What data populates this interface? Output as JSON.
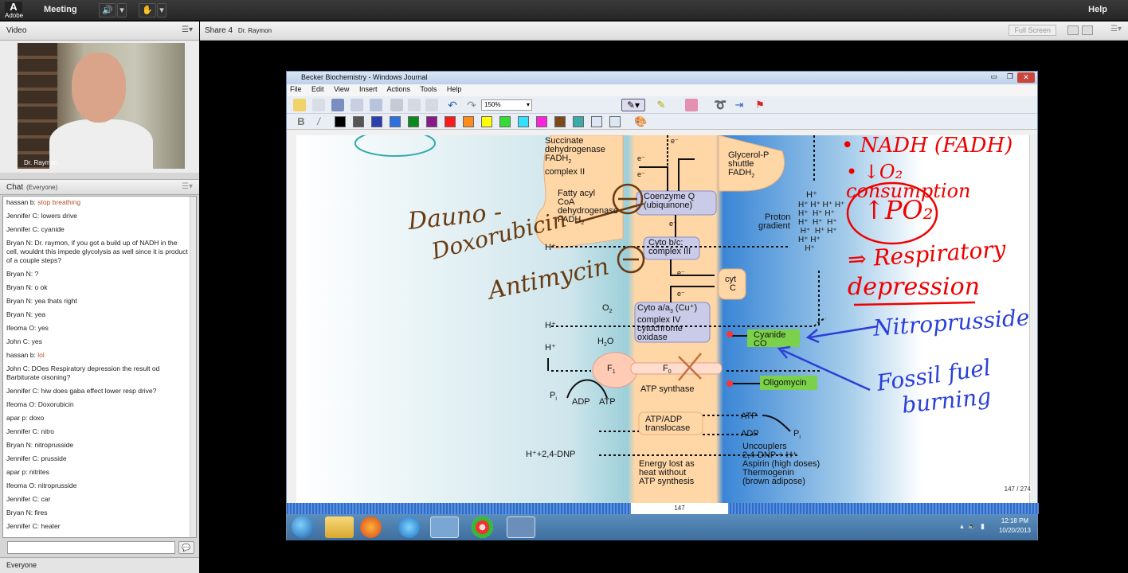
{
  "topbar": {
    "adobe": "Adobe",
    "meeting": "Meeting",
    "help": "Help"
  },
  "video_pod": {
    "title": "Video",
    "cam_label": "Dr. Raymon"
  },
  "chat_pod": {
    "title": "Chat",
    "audience": "(Everyone)",
    "footer": "Everyone",
    "messages": [
      {
        "user": "hassan b:",
        "text": "stop breathing",
        "highlight": true
      },
      {
        "user": "Jennifer C:",
        "text": "lowers drive"
      },
      {
        "user": "Jennifer C:",
        "text": "cyanide"
      },
      {
        "user": "Bryan N:",
        "text": "Dr. raymon, if you got a build up of NADH in the cell, wouldnt this impede glycolysis as well since it is product of a couple steps?"
      },
      {
        "user": "Bryan N:",
        "text": "?"
      },
      {
        "user": "Bryan N:",
        "text": "o ok"
      },
      {
        "user": "Bryan N:",
        "text": "yea thats right"
      },
      {
        "user": "Bryan N:",
        "text": "yea"
      },
      {
        "user": "Ifeoma O:",
        "text": "yes"
      },
      {
        "user": "John C:",
        "text": "yes"
      },
      {
        "user": "hassan b:",
        "text": "lol",
        "highlight": true
      },
      {
        "user": "John C:",
        "text": "DOes Respiratory depression the result od Barbiturate oisoning?"
      },
      {
        "user": "Jennifer C:",
        "text": "hiw does gaba effect lower resp drive?"
      },
      {
        "user": "Ifeoma O:",
        "text": "Doxorubicin"
      },
      {
        "user": "apar p:",
        "text": "doxo"
      },
      {
        "user": "Jennifer C:",
        "text": "nitro"
      },
      {
        "user": "Bryan N:",
        "text": "nitroprusside"
      },
      {
        "user": "Jennifer C:",
        "text": "prusside"
      },
      {
        "user": "apar p:",
        "text": "nitrites"
      },
      {
        "user": "Ifeoma O:",
        "text": "nitroprusside"
      },
      {
        "user": "Jennifer C:",
        "text": "car"
      },
      {
        "user": "Bryan N:",
        "text": "fires"
      },
      {
        "user": "Jennifer C:",
        "text": "heater"
      }
    ]
  },
  "share_pod": {
    "title": "Share 4",
    "presenter": "Dr. Raymon",
    "fullscreen": "Full Screen"
  },
  "journal": {
    "title": "Becker Biochemistry - Windows Journal",
    "menu": [
      "File",
      "Edit",
      "View",
      "Insert",
      "Actions",
      "Tools",
      "Help"
    ],
    "zoom": "150%",
    "page_counter": "147 / 274",
    "page_number": "147",
    "colors": [
      "#000000",
      "#555555",
      "#2a3fb0",
      "#2f6fe0",
      "#0a8a1e",
      "#8a1a8a",
      "#ff1a1a",
      "#ff8c1a",
      "#ffff00",
      "#33dd33",
      "#33e0ff",
      "#ff22dd",
      "#7a4a1a",
      "#3aaaaa",
      "#dde6f4",
      "#dde6f4"
    ]
  },
  "diagram": {
    "succinate": [
      "Succinate",
      "dehydrogenase",
      "FADH",
      "complex II"
    ],
    "fatty": [
      "Fatty acyl",
      "CoA",
      "dehydrogenase",
      "FADH"
    ],
    "glycerol": [
      "Glycerol-P",
      "shuttle",
      "FADH"
    ],
    "coq": [
      "Coenzyme Q",
      "(ubiquinone)"
    ],
    "cytbc": [
      "Cyto b/c:",
      "complex III"
    ],
    "cytc": [
      "cyt",
      "C"
    ],
    "cytaa": [
      "Cyto a/a",
      "complex IV",
      "cytochrome",
      "oxidase"
    ],
    "proton_gradient": [
      "Proton",
      "gradient"
    ],
    "cyanide": [
      "Cyanide",
      "CO"
    ],
    "oligomycin": "Oligomycin",
    "atp_synthase": "ATP synthase",
    "f1": "F",
    "f0": "F",
    "translocase": [
      "ATP/ADP",
      "translocase"
    ],
    "energy_lost": [
      "Energy lost as",
      "heat without",
      "ATP synthesis"
    ],
    "uncouplers": [
      "Uncouplers",
      "2,4-DNP + H⁺",
      "Aspirin (high doses)",
      "Thermogenin",
      "(brown adipose)"
    ],
    "dnp": "H⁺+2,4-DNP",
    "o2": "O",
    "h2o": "H",
    "adp": "ADP",
    "atp": "ATP",
    "atp_right": "ATP",
    "adp_right": "ADP",
    "pi": "P",
    "pi_right": "P",
    "h_plus": "H⁺",
    "e_minus": "e⁻"
  },
  "annotations": {
    "dauno": "Dauno -",
    "doxorubicin": "Doxorubicin",
    "antimycin": "Antimycin",
    "nadh": "• NADH (FADH)",
    "o2_consumption": "• ↓O₂ consumption",
    "po2": "↑PO₂",
    "respiratory": "⇒ Respiratory",
    "depression": "depression",
    "nitroprusside": "Nitroprusside",
    "fossil": "Fossil fuel",
    "burning": "burning"
  },
  "taskbar": {
    "time": "12:18 PM",
    "date": "10/20/2013"
  }
}
